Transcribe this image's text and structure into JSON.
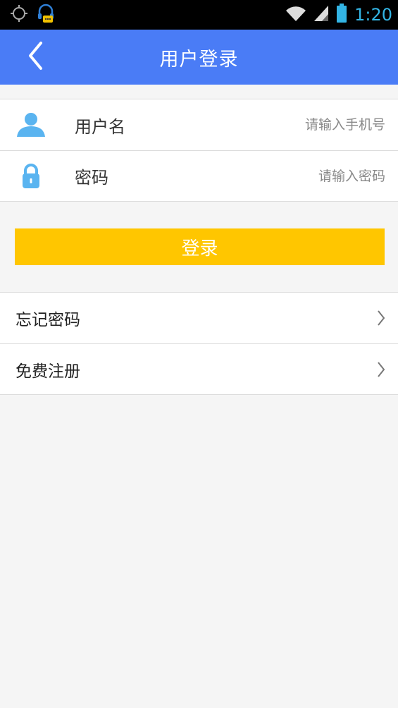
{
  "status_bar": {
    "time": "1:20",
    "icons": [
      "gps-icon",
      "headset-notification-icon",
      "wifi-icon",
      "signal-icon",
      "battery-icon"
    ]
  },
  "header": {
    "title": "用户登录",
    "back_icon": "back-arrow-icon"
  },
  "form": {
    "username": {
      "label": "用户名",
      "placeholder": "请输入手机号",
      "value": "",
      "icon": "user-icon"
    },
    "password": {
      "label": "密码",
      "placeholder": "请输入密码",
      "value": "",
      "icon": "lock-icon"
    }
  },
  "login_button": {
    "label": "登录"
  },
  "links": {
    "forgot_password": "忘记密码",
    "register": "免费注册"
  },
  "colors": {
    "header": "#4a7cf6",
    "login_button": "#ffc600",
    "icon": "#5ab4f0",
    "background": "#f5f5f5"
  }
}
